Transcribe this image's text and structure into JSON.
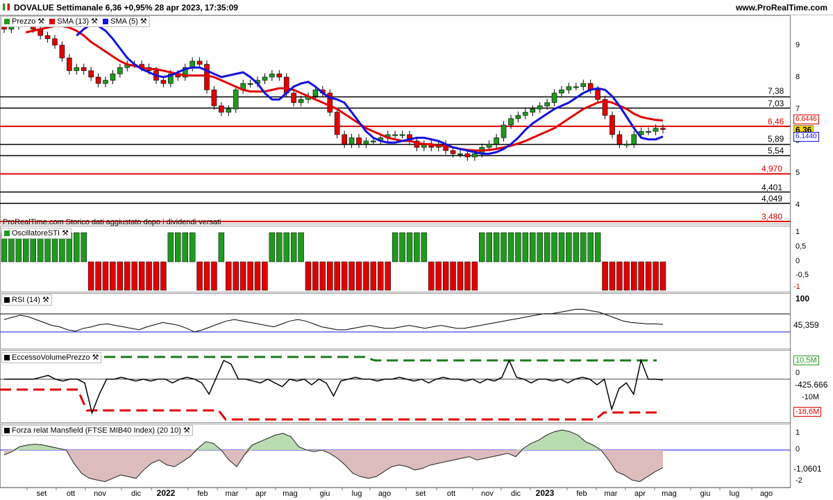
{
  "header": {
    "title": "DOVALUE Settimanale 6,36 +0,95% 28 apr 2023, 17:35:09",
    "site": "www.ProRealTime.com"
  },
  "price_panel": {
    "legend": {
      "price": "Prezzo",
      "sma13": "SMA (13)",
      "sma5": "SMA (5)"
    },
    "note": "ProRealTime.com Storico dati aggiustato dopo i dividendi versati",
    "levels": [
      {
        "value": 7.38,
        "label": "7,38",
        "color": "#000000"
      },
      {
        "value": 7.03,
        "label": "7,03",
        "color": "#000000"
      },
      {
        "value": 6.46,
        "label": "6,46",
        "color": "#e00000"
      },
      {
        "value": 5.89,
        "label": "5,89",
        "color": "#000000"
      },
      {
        "value": 5.54,
        "label": "5,54",
        "color": "#000000"
      },
      {
        "value": 4.97,
        "label": "4,970",
        "color": "#e00000"
      },
      {
        "value": 4.401,
        "label": "4,401",
        "color": "#000000"
      },
      {
        "value": 4.049,
        "label": "4,049",
        "color": "#000000"
      },
      {
        "value": 3.48,
        "label": "3,480",
        "color": "#e00000"
      }
    ],
    "axis_ticks": [
      "9",
      "8",
      "7",
      "6",
      "5",
      "4"
    ],
    "last_price": "6,36",
    "sma13_value": "6,6446",
    "sma5_value": "6,1440"
  },
  "sti_panel": {
    "legend": "OscillatoreSTI",
    "ticks": [
      "1",
      "0,5",
      "0",
      "-0,5",
      "-1"
    ]
  },
  "rsi_panel": {
    "legend": "RSI (14)",
    "tick_top": "100",
    "value": "45,359"
  },
  "evp_panel": {
    "legend": "EccessoVolumePrezzo",
    "upper": "10,5M",
    "zero": "0",
    "value": "-425.666",
    "tick": "-10M",
    "lower": "-18,6M"
  },
  "mans_panel": {
    "legend": "Forza relat Mansfield (FTSE MIB40 Index) (20 10)",
    "ticks": [
      "1",
      "0",
      "-2"
    ],
    "value": "-1,0601"
  },
  "x_axis": [
    "set",
    "ott",
    "nov",
    "dic",
    "2022",
    "feb",
    "mar",
    "apr",
    "mag",
    "giu",
    "lug",
    "ago",
    "set",
    "ott",
    "nov",
    "dic",
    "2023",
    "feb",
    "mar",
    "apr",
    "mag",
    "giu",
    "lug",
    "ago"
  ],
  "colors": {
    "up": "#1f9a1f",
    "down": "#e00000",
    "sma13": "#e00000",
    "sma5": "#1010e0",
    "rsi": "#000000"
  },
  "chart_data": {
    "type": "candlestick",
    "title": "DOVALUE Settimanale",
    "series": [
      {
        "name": "Prezzo",
        "close": [
          9.5,
          9.6,
          9.8,
          9.7,
          9.5,
          9.3,
          9.2,
          9.0,
          8.6,
          8.2,
          8.3,
          8.2,
          8.0,
          7.8,
          7.9,
          8.1,
          8.3,
          8.4,
          8.4,
          8.3,
          8.2,
          7.9,
          7.8,
          8.1,
          8.0,
          8.3,
          8.5,
          8.4,
          7.6,
          7.1,
          6.9,
          7.0,
          7.6,
          7.8,
          7.8,
          7.9,
          8.0,
          8.1,
          8.0,
          7.5,
          7.2,
          7.3,
          7.4,
          7.6,
          7.5,
          6.9,
          6.2,
          5.9,
          6.1,
          5.9,
          6.0,
          6.0,
          6.1,
          6.2,
          6.2,
          6.2,
          6.0,
          5.8,
          5.9,
          5.8,
          5.9,
          5.7,
          5.6,
          5.6,
          5.5,
          5.6,
          5.8,
          5.9,
          6.1,
          6.5,
          6.7,
          6.8,
          6.9,
          7.0,
          7.1,
          7.2,
          7.5,
          7.6,
          7.7,
          7.7,
          7.8,
          7.6,
          7.3,
          6.8,
          6.2,
          5.9,
          5.9,
          6.2,
          6.3,
          6.3,
          6.4,
          6.36
        ]
      },
      {
        "name": "SMA (13)",
        "values": [
          9.4,
          9.45,
          9.5,
          9.55,
          9.6,
          9.6,
          9.55,
          9.45,
          9.3,
          9.1,
          8.95,
          8.8,
          8.65,
          8.5,
          8.4,
          8.35,
          8.3,
          8.25,
          8.25,
          8.2,
          8.15,
          8.1,
          8.05,
          8.05,
          8.05,
          8.05,
          8.0,
          7.9,
          7.8,
          7.7,
          7.6,
          7.55,
          7.55,
          7.55,
          7.6,
          7.65,
          7.65,
          7.6,
          7.5,
          7.4,
          7.3,
          7.2,
          7.1,
          7.0,
          6.85,
          6.7,
          6.55,
          6.4,
          6.3,
          6.2,
          6.1,
          6.05,
          6.0,
          6.0,
          5.95,
          5.9,
          5.9,
          5.85,
          5.85,
          5.8,
          5.75,
          5.72,
          5.7,
          5.7,
          5.72,
          5.75,
          5.8,
          5.85,
          5.92,
          6.0,
          6.1,
          6.2,
          6.3,
          6.4,
          6.55,
          6.7,
          6.85,
          7.0,
          7.1,
          7.2,
          7.25,
          7.2,
          7.1,
          7.0,
          6.85,
          6.75,
          6.7,
          6.66,
          6.64
        ]
      },
      {
        "name": "SMA (5)",
        "values": [
          9.3,
          9.5,
          9.65,
          9.6,
          9.45,
          9.2,
          8.9,
          8.6,
          8.4,
          8.25,
          8.15,
          8.05,
          8.0,
          8.05,
          8.15,
          8.25,
          8.3,
          8.3,
          8.2,
          8.1,
          8.0,
          8.05,
          8.1,
          8.15,
          8.0,
          7.8,
          7.5,
          7.3,
          7.3,
          7.5,
          7.7,
          7.8,
          7.85,
          7.7,
          7.5,
          7.35,
          7.3,
          7.2,
          6.9,
          6.6,
          6.3,
          6.1,
          6.0,
          5.95,
          5.95,
          6.0,
          6.05,
          6.1,
          6.1,
          6.05,
          6.0,
          5.9,
          5.8,
          5.75,
          5.7,
          5.65,
          5.6,
          5.6,
          5.65,
          5.75,
          5.9,
          6.1,
          6.35,
          6.55,
          6.7,
          6.85,
          7.0,
          7.1,
          7.2,
          7.35,
          7.5,
          7.6,
          7.65,
          7.6,
          7.4,
          7.1,
          6.75,
          6.4,
          6.1,
          6.05,
          6.05,
          6.14
        ]
      }
    ],
    "sti_signal": [
      1,
      1,
      1,
      1,
      1,
      1,
      1,
      1,
      1,
      1,
      1,
      1,
      -1,
      -1,
      -1,
      -1,
      -1,
      -1,
      -1,
      -1,
      -1,
      -1,
      -1,
      1,
      1,
      1,
      1,
      -1,
      -1,
      -1,
      1,
      -1,
      -1,
      -1,
      -1,
      -1,
      -1,
      1,
      1,
      1,
      1,
      1,
      -1,
      -1,
      -1,
      -1,
      -1,
      -1,
      -1,
      -1,
      -1,
      -1,
      -1,
      -1,
      1,
      1,
      1,
      1,
      1,
      -1,
      -1,
      -1,
      -1,
      -1,
      -1,
      -1,
      1,
      1,
      1,
      1,
      1,
      1,
      1,
      1,
      1,
      1,
      1,
      1,
      1,
      1,
      1,
      1,
      1,
      -1,
      -1,
      -1,
      -1,
      -1,
      -1,
      -1,
      -1,
      -1
    ],
    "rsi": [
      52,
      55,
      58,
      56,
      52,
      48,
      44,
      42,
      38,
      36,
      40,
      42,
      45,
      46,
      44,
      42,
      40,
      38,
      42,
      45,
      48,
      46,
      44,
      40,
      35,
      38,
      42,
      46,
      50,
      52,
      50,
      48,
      46,
      44,
      42,
      46,
      50,
      52,
      50,
      46,
      42,
      40,
      38,
      38,
      40,
      42,
      44,
      42,
      40,
      40,
      42,
      44,
      42,
      40,
      42,
      44,
      42,
      40,
      40,
      42,
      44,
      46,
      48,
      50,
      52,
      54,
      56,
      58,
      60,
      60,
      62,
      64,
      66,
      66,
      64,
      62,
      58,
      54,
      50,
      48,
      47,
      46,
      46,
      45.4
    ],
    "evp": [
      0,
      0,
      0,
      0,
      0,
      1,
      2,
      0,
      -1,
      0,
      0,
      -2,
      -18,
      -8,
      0,
      0,
      1,
      0,
      -1,
      0,
      -1,
      0,
      0,
      -2,
      0,
      1,
      0,
      -2,
      -8,
      1,
      10,
      8,
      0,
      0,
      -1,
      -2,
      0,
      -2,
      -4,
      0,
      -1,
      0,
      -3,
      0,
      -2,
      -9,
      -1,
      0,
      1,
      0,
      0,
      -1,
      0,
      0,
      1,
      0,
      -1,
      0,
      -2,
      0,
      1,
      0,
      0,
      -1,
      0,
      -2,
      0,
      -1,
      1,
      10,
      1,
      0,
      -2,
      0,
      0,
      -1,
      0,
      -2,
      0,
      1,
      0,
      -3,
      0,
      -16,
      -5,
      -2,
      -8,
      10,
      0,
      0,
      -0.4
    ],
    "mansfield": [
      -0.3,
      -0.1,
      0.2,
      0.3,
      0.35,
      0.3,
      0.2,
      0.1,
      0.0,
      -0.8,
      -1.4,
      -1.7,
      -1.8,
      -1.9,
      -1.7,
      -1.5,
      -1.6,
      -1.7,
      -1.2,
      -0.8,
      -0.6,
      -0.9,
      -1.0,
      -0.7,
      -0.4,
      0.1,
      0.5,
      0.4,
      0.0,
      -0.6,
      -1.0,
      -0.3,
      0.3,
      0.5,
      0.7,
      0.9,
      1.0,
      0.8,
      0.2,
      0.0,
      -0.1,
      0.0,
      -0.2,
      -0.5,
      -0.9,
      -1.4,
      -1.6,
      -1.7,
      -1.6,
      -1.3,
      -1.0,
      -0.9,
      -1.0,
      -1.2,
      -1.1,
      -0.9,
      -0.8,
      -0.7,
      -0.6,
      -0.5,
      -0.4,
      -0.6,
      -0.5,
      -0.4,
      -0.3,
      -0.2,
      -0.4,
      0.1,
      0.4,
      0.6,
      0.9,
      1.1,
      1.2,
      1.1,
      0.9,
      0.5,
      0.3,
      0.0,
      -0.6,
      -1.3,
      -1.5,
      -1.8,
      -1.9,
      -1.6,
      -1.3,
      -1.06
    ]
  }
}
